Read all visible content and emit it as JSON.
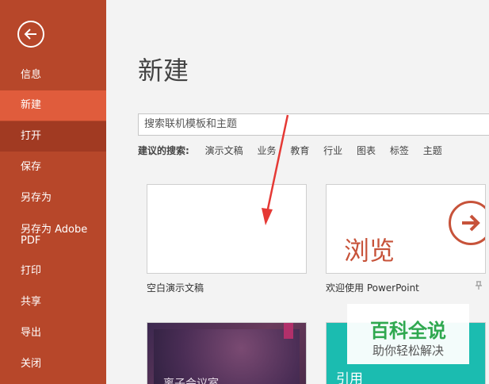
{
  "sidebar": {
    "items": [
      {
        "label": "信息"
      },
      {
        "label": "新建"
      },
      {
        "label": "打开"
      },
      {
        "label": "保存"
      },
      {
        "label": "另存为"
      },
      {
        "label": "另存为 Adobe PDF"
      },
      {
        "label": "打印"
      },
      {
        "label": "共享"
      },
      {
        "label": "导出"
      },
      {
        "label": "关闭"
      }
    ]
  },
  "main": {
    "title": "新建",
    "search_placeholder": "搜索联机模板和主题",
    "suggest_label": "建议的搜索:",
    "suggestions": [
      "演示文稿",
      "业务",
      "教育",
      "行业",
      "图表",
      "标签",
      "主题"
    ],
    "templates": [
      {
        "caption": "空白演示文稿"
      },
      {
        "caption": "欢迎使用 PowerPoint",
        "preview_text": "浏览"
      },
      {
        "caption": "",
        "preview_text": "离子会议室"
      },
      {
        "caption": "",
        "preview_text": "引用"
      }
    ]
  },
  "watermark": {
    "title": "百科全说",
    "subtitle": "助你轻松解决"
  },
  "colors": {
    "sidebar": "#b7472a",
    "active": "#e05c3c",
    "accent": "#c7533a",
    "teal": "#1bbcb0"
  }
}
